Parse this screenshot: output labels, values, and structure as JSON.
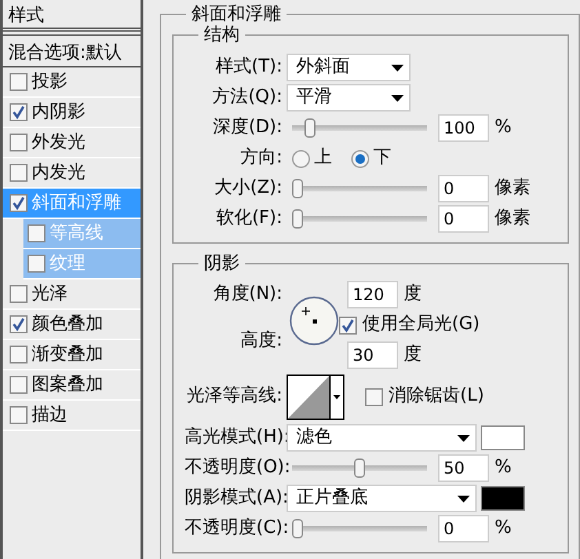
{
  "sidebar": {
    "header": "样式",
    "blend_options": "混合选项:默认",
    "items": [
      {
        "label": "投影",
        "checked": false,
        "selected": false
      },
      {
        "label": "内阴影",
        "checked": true,
        "selected": false
      },
      {
        "label": "外发光",
        "checked": false,
        "selected": false
      },
      {
        "label": "内发光",
        "checked": false,
        "selected": false
      },
      {
        "label": "斜面和浮雕",
        "checked": true,
        "selected": true,
        "children": [
          {
            "label": "等高线",
            "checked": false,
            "selected": false
          },
          {
            "label": "纹理",
            "checked": false,
            "selected": false
          }
        ]
      },
      {
        "label": "光泽",
        "checked": false,
        "selected": false
      },
      {
        "label": "颜色叠加",
        "checked": true,
        "selected": false
      },
      {
        "label": "渐变叠加",
        "checked": false,
        "selected": false
      },
      {
        "label": "图案叠加",
        "checked": false,
        "selected": false
      },
      {
        "label": "描边",
        "checked": false,
        "selected": false
      }
    ]
  },
  "panel": {
    "title": "斜面和浮雕",
    "structure": {
      "title": "结构",
      "rows": [
        {
          "kind": "select",
          "label": "样式(T):",
          "value": "外斜面"
        },
        {
          "kind": "select",
          "label": "方法(Q):",
          "value": "平滑"
        },
        {
          "kind": "slider",
          "label": "深度(D):",
          "level": 0.1,
          "value": "100",
          "unit": "%"
        },
        {
          "kind": "radio",
          "label": "方向:",
          "options": [
            {
              "label": "上",
              "selected": false
            },
            {
              "label": "下",
              "selected": true
            }
          ]
        },
        {
          "kind": "slider",
          "label": "大小(Z):",
          "level": 0,
          "value": "0",
          "unit": "像素"
        },
        {
          "kind": "slider",
          "label": "软化(F):",
          "level": 0,
          "value": "0",
          "unit": "像素"
        }
      ]
    },
    "shading": {
      "title": "阴影",
      "angle": {
        "label": "角度(N):",
        "value": "120",
        "unit": "度"
      },
      "global_light": {
        "label": "使用全局光(G)",
        "checked": true
      },
      "altitude": {
        "label": "高度:",
        "value": "30",
        "unit": "度"
      },
      "gloss_contour": {
        "label": "光泽等高线:"
      },
      "anti_alias": {
        "label": "消除锯齿(L)",
        "checked": false
      },
      "rows": [
        {
          "kind": "select",
          "label": "高光模式(H):",
          "value": "滤色",
          "color": "#ffffff"
        },
        {
          "kind": "slider",
          "label": "不透明度(O):",
          "level": 0.5,
          "value": "50",
          "unit": "%"
        },
        {
          "kind": "select",
          "label": "阴影模式(A):",
          "value": "正片叠底",
          "color": "#000000"
        },
        {
          "kind": "slider",
          "label": "不透明度(C):",
          "level": 0,
          "value": "0",
          "unit": "%"
        }
      ]
    }
  }
}
